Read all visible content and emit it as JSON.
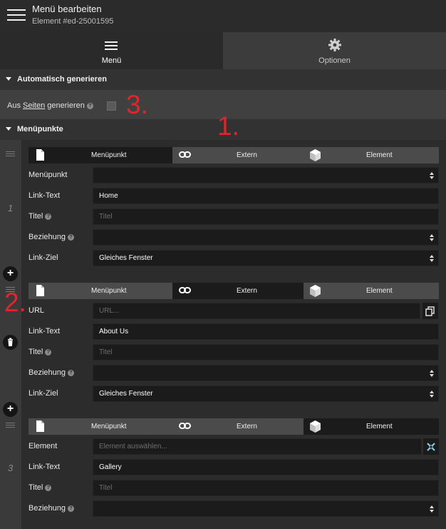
{
  "header": {
    "title": "Menü bearbeiten",
    "subtitle": "Element #ed-25001595"
  },
  "main_tabs": [
    {
      "label": "Menü",
      "active": true
    },
    {
      "label": "Optionen",
      "active": false
    }
  ],
  "auto_generate": {
    "heading": "Automatisch generieren",
    "label_prefix": "Aus ",
    "label_link": "Seiten",
    "label_suffix": " generieren",
    "checked": false
  },
  "items_heading": "Menüpunkte",
  "annotations": {
    "one": "1.",
    "two": "2.",
    "three": "3."
  },
  "type_tabs": {
    "menupunkt": "Menüpunkt",
    "extern": "Extern",
    "element": "Element"
  },
  "items": [
    {
      "number": "1",
      "selected_type": "Menüpunkt",
      "fields": {
        "menupunkt_label": "Menüpunkt",
        "menupunkt_value": "",
        "link_text_label": "Link-Text",
        "link_text_value": "Home",
        "titel_label": "Titel",
        "titel_placeholder": "Titel",
        "beziehung_label": "Beziehung",
        "beziehung_value": "",
        "link_ziel_label": "Link-Ziel",
        "link_ziel_value": "Gleiches Fenster"
      }
    },
    {
      "number": "2",
      "selected_type": "Extern",
      "fields": {
        "url_label": "URL",
        "url_placeholder": "URL...",
        "link_text_label": "Link-Text",
        "link_text_value": "About Us",
        "titel_label": "Titel",
        "titel_placeholder": "Titel",
        "beziehung_label": "Beziehung",
        "beziehung_value": "",
        "link_ziel_label": "Link-Ziel",
        "link_ziel_value": "Gleiches Fenster"
      }
    },
    {
      "number": "3",
      "selected_type": "Element",
      "fields": {
        "element_label": "Element",
        "element_placeholder": "Element auswählen...",
        "link_text_label": "Link-Text",
        "link_text_value": "Gallery",
        "titel_label": "Titel",
        "titel_placeholder": "Titel",
        "beziehung_label": "Beziehung",
        "beziehung_value": ""
      }
    }
  ],
  "colors": {
    "annotation_red": "#e3242b",
    "field_bg": "#1b1b1b",
    "panel_bg": "#2c2c2c"
  }
}
